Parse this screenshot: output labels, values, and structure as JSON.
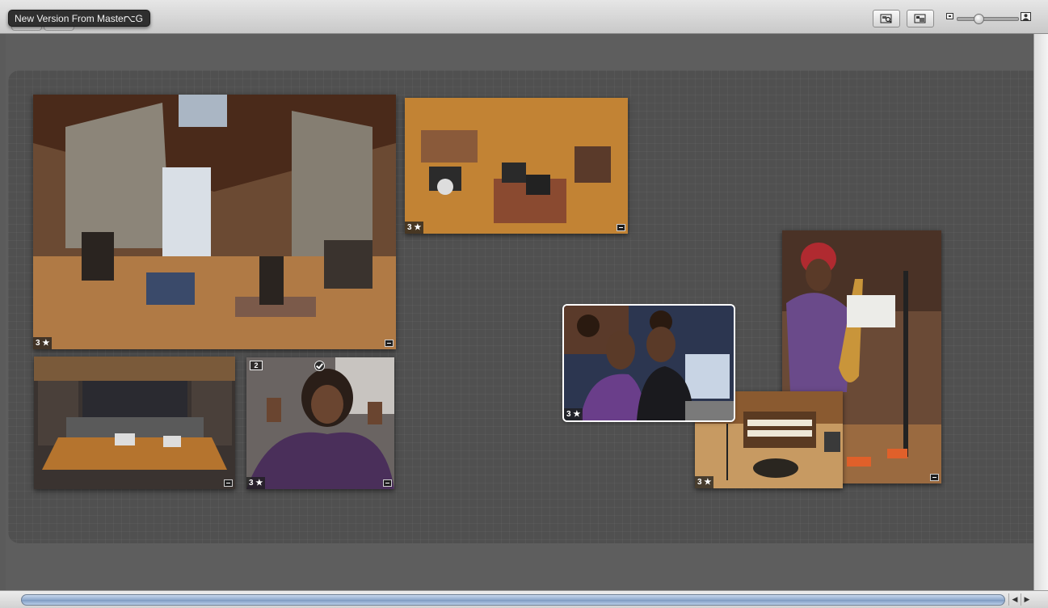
{
  "toolbar": {
    "tooltip_text": "New Version From Master",
    "tooltip_shortcut": "⌥G"
  },
  "zoom": {
    "level": 0.33
  },
  "photos": [
    {
      "name": "studio-wide",
      "rating": "3 ★"
    },
    {
      "name": "overhead-band",
      "rating": "3 ★"
    },
    {
      "name": "control-room",
      "rating": ""
    },
    {
      "name": "portrait-dreadlocks",
      "rating": "3 ★",
      "stack_count": "2"
    },
    {
      "name": "two-men-console",
      "rating": "3 ★"
    },
    {
      "name": "organ",
      "rating": "3 ★"
    },
    {
      "name": "saxophonist",
      "rating": ""
    }
  ],
  "colors": {
    "selection": "#ffffff",
    "scroll_thumb": "#8ea9cc",
    "board": "#505050"
  }
}
